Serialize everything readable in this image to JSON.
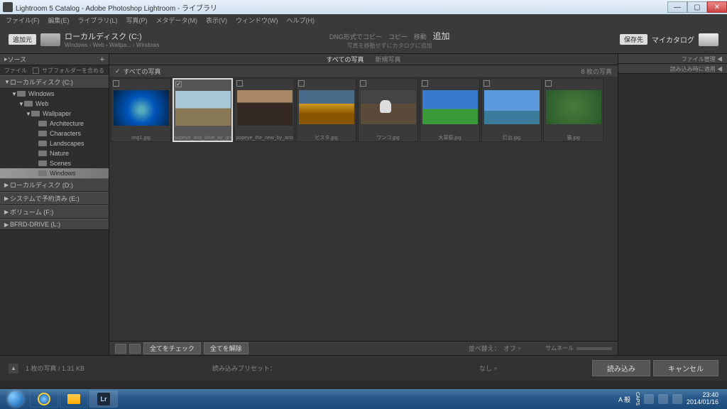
{
  "titlebar": {
    "title": "Lightroom 5 Catalog - Adobe Photoshop Lightroom - ライブラリ"
  },
  "menu": [
    "ファイル(F)",
    "編集(E)",
    "ライブラリ(L)",
    "写真(P)",
    "メタデータ(M)",
    "表示(V)",
    "ウィンドウ(W)",
    "ヘルプ(H)"
  ],
  "import_header": {
    "source_badge": "追加元",
    "source_drive": "ローカルディスク (C:)",
    "source_path": "Windows › Web › Wallpa... › Windows",
    "copy_tabs": "DNG形式でコピー　コピー　移動",
    "copy_active": "追加",
    "copy_sub": "写真を移動せずにカタログに追加",
    "dest_badge": "保存先",
    "dest_label": "マイカタログ"
  },
  "left_panel": {
    "header": "ソース",
    "file_label": "ファイル",
    "subfolders": "サブフォルダーを含める",
    "drives": [
      {
        "name": "ローカルディスク (C:)",
        "expanded": true
      },
      {
        "name": "ローカルディスク (D:)"
      },
      {
        "name": "システムで予約済み (E:)"
      },
      {
        "name": "ボリューム (F:)"
      },
      {
        "name": "BFRD-DRIVE (L:)"
      }
    ],
    "tree": [
      {
        "name": "Windows",
        "indent": 1,
        "caret": "▼"
      },
      {
        "name": "Web",
        "indent": 2,
        "caret": "▼"
      },
      {
        "name": "Wallpaper",
        "indent": 3,
        "caret": "▼"
      },
      {
        "name": "Architecture",
        "indent": 4
      },
      {
        "name": "Characters",
        "indent": 4
      },
      {
        "name": "Landscapes",
        "indent": 4
      },
      {
        "name": "Nature",
        "indent": 4
      },
      {
        "name": "Scenes",
        "indent": 4
      },
      {
        "name": "Windows",
        "indent": 4,
        "selected": true
      }
    ]
  },
  "right_panel": {
    "header": "ファイル管理 ◀",
    "apply": "読み込み時に適用 ◀"
  },
  "center": {
    "tab_all": "すべての写真",
    "tab_new": "新規写真",
    "select_all": "すべての写真",
    "count": "8 枚の写真",
    "thumbs": [
      {
        "name": "img1.jpg",
        "cls": "img-win",
        "checked": false,
        "sel": false
      },
      {
        "name": "popeye_and_olive_by_greedy.j...",
        "cls": "img-toy",
        "checked": true,
        "sel": true
      },
      {
        "name": "popeye_the_new_by_artistitop...",
        "cls": "img-man",
        "checked": false,
        "sel": false
      },
      {
        "name": "ビスタ.jpg",
        "cls": "img-field",
        "checked": false,
        "sel": false
      },
      {
        "name": "ワンコ.jpg",
        "cls": "img-dog",
        "checked": false,
        "sel": false
      },
      {
        "name": "大草原.jpg",
        "cls": "img-grass",
        "checked": false,
        "sel": false
      },
      {
        "name": "灯台.jpg",
        "cls": "img-tv",
        "checked": false,
        "sel": false
      },
      {
        "name": "猫.jpg",
        "cls": "img-cat",
        "checked": false,
        "sel": false
      }
    ]
  },
  "bottom": {
    "check_all": "全てをチェック",
    "uncheck_all": "全てを解除",
    "sort_label": "並べ替え：",
    "sort_value": "オフ ÷",
    "thumb_label": "サムネール"
  },
  "footer": {
    "status": "1 枚の写真 / 1.31 KB",
    "preset_label": "読み込みプリセット：",
    "preset_value": "なし ÷",
    "import_btn": "読み込み",
    "cancel_btn": "キャンセル"
  },
  "taskbar": {
    "ime": "A 般",
    "caps": "CAPS",
    "time": "23:40",
    "date": "2014/01/16"
  }
}
